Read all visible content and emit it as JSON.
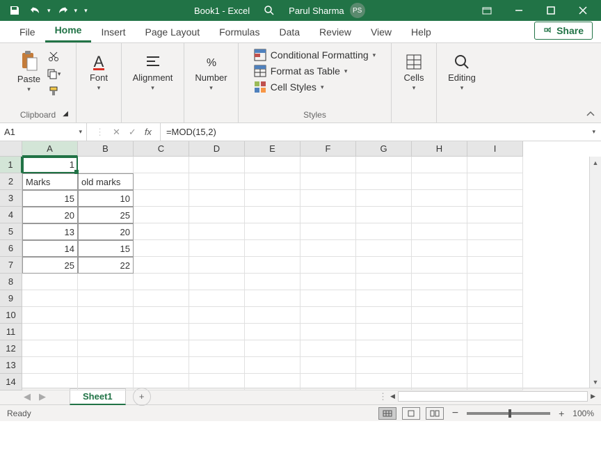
{
  "title_bar": {
    "app_title": "Book1 - Excel",
    "user_name": "Parul Sharma",
    "user_initials": "PS"
  },
  "ribbon_tabs": [
    "File",
    "Home",
    "Insert",
    "Page Layout",
    "Formulas",
    "Data",
    "Review",
    "View",
    "Help"
  ],
  "share_label": "Share",
  "ribbon": {
    "clipboard": {
      "paste": "Paste",
      "label": "Clipboard"
    },
    "font": {
      "label": "Font"
    },
    "alignment": {
      "label": "Alignment"
    },
    "number": {
      "label": "Number"
    },
    "styles": {
      "conditional_formatting": "Conditional Formatting",
      "format_as_table": "Format as Table",
      "cell_styles": "Cell Styles",
      "label": "Styles"
    },
    "cells": {
      "label": "Cells"
    },
    "editing": {
      "label": "Editing"
    }
  },
  "formula_bar": {
    "name_box": "A1",
    "formula": "=MOD(15,2)"
  },
  "grid": {
    "columns": [
      "A",
      "B",
      "C",
      "D",
      "E",
      "F",
      "G",
      "H",
      "I"
    ],
    "row_count": 14,
    "selected_col": 0,
    "selected_row": 0,
    "cells": {
      "A1": {
        "v": "1",
        "align": "right"
      },
      "A2": {
        "v": "Marks",
        "align": "left",
        "border": true
      },
      "B2": {
        "v": "old marks",
        "align": "left",
        "border": true
      },
      "A3": {
        "v": "15",
        "align": "right",
        "border": true
      },
      "B3": {
        "v": "10",
        "align": "right",
        "border": true
      },
      "A4": {
        "v": "20",
        "align": "right",
        "border": true
      },
      "B4": {
        "v": "25",
        "align": "right",
        "border": true
      },
      "A5": {
        "v": "13",
        "align": "right",
        "border": true
      },
      "B5": {
        "v": "20",
        "align": "right",
        "border": true
      },
      "A6": {
        "v": "14",
        "align": "right",
        "border": true
      },
      "B6": {
        "v": "15",
        "align": "right",
        "border": true
      },
      "A7": {
        "v": "25",
        "align": "right",
        "border": true
      },
      "B7": {
        "v": "22",
        "align": "right",
        "border": true
      }
    }
  },
  "sheet_tabs": {
    "active": "Sheet1"
  },
  "status_bar": {
    "ready": "Ready",
    "zoom": "100%"
  }
}
